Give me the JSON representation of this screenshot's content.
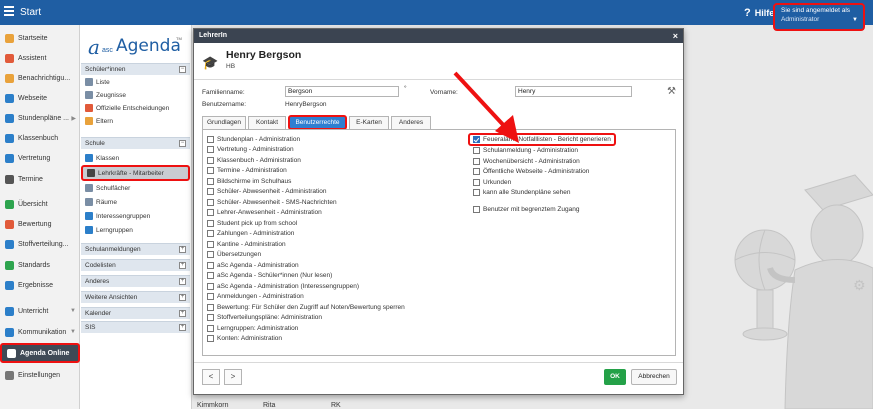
{
  "app": {
    "title": "Start",
    "help_label": "Hilfe",
    "help_icon": "?"
  },
  "user_menu": {
    "heading": "Sie sind angemeldet als",
    "role": "Administrator",
    "caret": "▼"
  },
  "left_nav": {
    "items": [
      {
        "label": "Startseite",
        "icon": "home-icon",
        "color": "#e9a23b"
      },
      {
        "label": "Assistent",
        "icon": "wand-icon",
        "color": "#e15a3a"
      },
      {
        "label": "Benachrichtigu...",
        "icon": "mail-icon",
        "color": "#e9a23b"
      },
      {
        "label": "Webseite",
        "icon": "globe-icon",
        "color": "#2c7fc9"
      },
      {
        "label": "Stundenpläne ...",
        "icon": "timetable-icon",
        "color": "#2c7fc9",
        "arrow": "▶"
      },
      {
        "label": "Klassenbuch",
        "icon": "book-icon",
        "color": "#2c7fc9"
      },
      {
        "label": "Vertretung",
        "icon": "substitution-icon",
        "color": "#2c7fc9"
      },
      {
        "label": "Termine",
        "icon": "calendar-icon",
        "color": "#555555"
      },
      {
        "label": "Übersicht",
        "icon": "overview-icon",
        "color": "#2da44e"
      },
      {
        "label": "Bewertung",
        "icon": "grade-icon",
        "color": "#e15a3a"
      },
      {
        "label": "Stoffverteilung...",
        "icon": "curriculum-icon",
        "color": "#2c7fc9"
      },
      {
        "label": "Standards",
        "icon": "shield-icon",
        "color": "#2da44e"
      },
      {
        "label": "Ergebnisse",
        "icon": "results-icon",
        "color": "#2c7fc9"
      },
      {
        "label": "Unterricht",
        "icon": "lesson-icon",
        "color": "#2c7fc9",
        "arrow": "▼"
      },
      {
        "label": "Kommunikation",
        "icon": "chat-icon",
        "color": "#2c7fc9",
        "arrow": "▼"
      },
      {
        "label": "Agenda Online",
        "icon": "agenda-icon",
        "color": "#ffffff"
      },
      {
        "label": "Einstellungen",
        "icon": "gear-icon",
        "color": "#777777"
      }
    ]
  },
  "second_nav": {
    "logo": {
      "mark": "a",
      "sub": "asc",
      "name": "Agenda",
      "tm": "TM"
    },
    "sections": [
      {
        "title": "Schüler*innen",
        "toggle": "−"
      },
      {
        "title": "Schule",
        "toggle": "−"
      },
      {
        "title": "Schulanmeldungen",
        "toggle": "+"
      },
      {
        "title": "Codelisten",
        "toggle": "+"
      },
      {
        "title": "Anderes",
        "toggle": "+"
      },
      {
        "title": "Weitere Ansichten",
        "toggle": "+"
      },
      {
        "title": "Kalender",
        "toggle": "+"
      },
      {
        "title": "SIS",
        "toggle": "+"
      }
    ],
    "student_items": [
      "Liste",
      "Zeugnisse",
      "Offizielle Entscheidungen",
      "Eltern"
    ],
    "school_items": [
      "Klassen",
      "Lehrkräfte - Mitarbeiter",
      "Schulfächer",
      "Räume",
      "Interessengruppen",
      "Lerngruppen"
    ]
  },
  "dialog": {
    "title": "LehrerIn",
    "close": "×",
    "person_name": "Henry Bergson",
    "short": "HB",
    "fields": {
      "lastname_label": "Familienname:",
      "lastname_value": "Bergson",
      "degree_mark": "°",
      "firstname_label": "Vorname:",
      "firstname_value": "Henry",
      "username_label": "Benutzername:",
      "username_value": "HenryBergson"
    },
    "tools_icon": "⚒",
    "tabs": [
      "Grundlagen",
      "Kontakt",
      "Benutzerrechte",
      "E-Karten",
      "Anderes"
    ],
    "active_tab": "Benutzerrechte",
    "permissions_left": [
      {
        "label": "Stundenplan - Administration",
        "checked": false
      },
      {
        "label": "Vertretung - Administration",
        "checked": false
      },
      {
        "label": "Klassenbuch - Administration",
        "checked": false
      },
      {
        "label": "Termine - Administration",
        "checked": false
      },
      {
        "label": "Bildschirme im Schulhaus",
        "checked": false
      },
      {
        "label": "Schüler- Abwesenheit - Administration",
        "checked": false
      },
      {
        "label": "Schüler- Abwesenheit - SMS-Nachrichten",
        "checked": false
      },
      {
        "label": "Lehrer-Anwesenheit - Administration",
        "checked": false
      },
      {
        "label": "Student pick up from school",
        "checked": false
      },
      {
        "label": "Zahlungen - Administration",
        "checked": false
      },
      {
        "label": "Kantine - Administration",
        "checked": false
      },
      {
        "label": "Übersetzungen",
        "checked": false
      },
      {
        "label": "aSc Agenda - Administration",
        "checked": false
      },
      {
        "label": "aSc Agenda - Schüler*innen (Nur lesen)",
        "checked": false
      },
      {
        "label": "aSc Agenda - Administration (Interessengruppen)",
        "checked": false
      },
      {
        "label": "Anmeldungen - Administration",
        "checked": false
      },
      {
        "label": "Bewertung: Für Schüler den Zugriff auf Noten/Bewertung sperren",
        "checked": false
      },
      {
        "label": "Stoffverteilungspläne: Administration",
        "checked": false
      },
      {
        "label": "Lerngruppen: Administration",
        "checked": false
      },
      {
        "label": "Konten: Administration",
        "checked": false
      }
    ],
    "permissions_right": [
      {
        "label": "Feueralarm-Notfalllisten - Bericht generieren",
        "checked": true
      },
      {
        "label": "Schulanmeldung - Administration",
        "checked": false
      },
      {
        "label": "Wochenübersicht - Administration",
        "checked": false
      },
      {
        "label": "Öffentliche Webseite - Administration",
        "checked": false
      },
      {
        "label": "Urkunden",
        "checked": false
      },
      {
        "label": "kann alle Stundenpläne sehen",
        "checked": false
      },
      {
        "label": "Benutzer mit begrenztem Zugang",
        "checked": false
      }
    ],
    "prev_label": "<",
    "next_label": ">",
    "ok_label": "OK",
    "cancel_label": "Abbrechen"
  },
  "background_table": {
    "cells": [
      "Kimmkorn",
      "Rita",
      "RK"
    ]
  },
  "colors": {
    "topbar": "#1f5ea3",
    "highlight": "#e11111",
    "ok": "#24a148",
    "tab_active": "#2e7fd1"
  }
}
